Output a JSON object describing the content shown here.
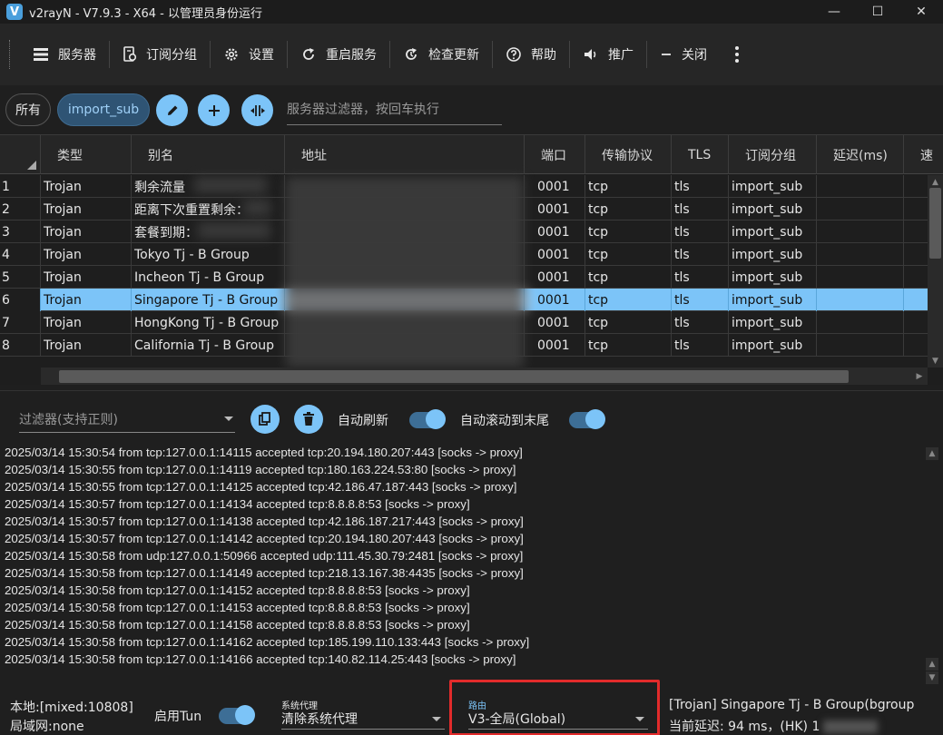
{
  "window": {
    "logo_letter": "V",
    "title": "v2rayN - V7.9.3 - X64 - 以管理员身份运行",
    "controls": {
      "minimize": "—",
      "maximize": "☐",
      "close": "✕"
    }
  },
  "toolbar": {
    "servers": "服务器",
    "subscription_group": "订阅分组",
    "settings": "设置",
    "restart_service": "重启服务",
    "check_update": "检查更新",
    "help": "帮助",
    "promote": "推广",
    "close": "关闭"
  },
  "filterbar": {
    "chip_all": "所有",
    "chip_sub": "import_sub",
    "server_filter_placeholder": "服务器过滤器，按回车执行"
  },
  "grid": {
    "columns": [
      "类型",
      "别名",
      "地址",
      "端口",
      "传输协议",
      "TLS",
      "订阅分组",
      "延迟(ms)",
      "速"
    ],
    "rows": [
      {
        "idx": "1",
        "type": "Trojan",
        "alias": "剩余流量",
        "port": "0001",
        "transport": "tcp",
        "tls": "tls",
        "sub": "import_sub"
      },
      {
        "idx": "2",
        "type": "Trojan",
        "alias": "距离下次重置剩余：",
        "port": "0001",
        "transport": "tcp",
        "tls": "tls",
        "sub": "import_sub"
      },
      {
        "idx": "3",
        "type": "Trojan",
        "alias": "套餐到期：",
        "port": "0001",
        "transport": "tcp",
        "tls": "tls",
        "sub": "import_sub"
      },
      {
        "idx": "4",
        "type": "Trojan",
        "alias": "Tokyo Tj - B Group",
        "port": "0001",
        "transport": "tcp",
        "tls": "tls",
        "sub": "import_sub"
      },
      {
        "idx": "5",
        "type": "Trojan",
        "alias": "Incheon Tj - B Group",
        "port": "0001",
        "transport": "tcp",
        "tls": "tls",
        "sub": "import_sub"
      },
      {
        "idx": "6",
        "type": "Trojan",
        "alias": "Singapore Tj - B Group",
        "port": "0001",
        "transport": "tcp",
        "tls": "tls",
        "sub": "import_sub",
        "selected": true
      },
      {
        "idx": "7",
        "type": "Trojan",
        "alias": "HongKong Tj - B Group",
        "port": "0001",
        "transport": "tcp",
        "tls": "tls",
        "sub": "import_sub"
      },
      {
        "idx": "8",
        "type": "Trojan",
        "alias": "California Tj - B Group",
        "port": "0001",
        "transport": "tcp",
        "tls": "tls",
        "sub": "import_sub"
      }
    ]
  },
  "log": {
    "filter_placeholder": "过滤器(支持正则)",
    "auto_refresh": "自动刷新",
    "auto_scroll": "自动滚动到末尾",
    "lines": [
      "2025/03/14 15:30:54 from tcp:127.0.0.1:14115 accepted tcp:20.194.180.207:443 [socks -> proxy]",
      "2025/03/14 15:30:55 from tcp:127.0.0.1:14119 accepted tcp:180.163.224.53:80 [socks -> proxy]",
      "2025/03/14 15:30:55 from tcp:127.0.0.1:14125 accepted tcp:42.186.47.187:443 [socks -> proxy]",
      "2025/03/14 15:30:57 from tcp:127.0.0.1:14134 accepted tcp:8.8.8.8:53 [socks -> proxy]",
      "2025/03/14 15:30:57 from tcp:127.0.0.1:14138 accepted tcp:42.186.187.217:443 [socks -> proxy]",
      "2025/03/14 15:30:57 from tcp:127.0.0.1:14142 accepted tcp:20.194.180.207:443 [socks -> proxy]",
      "2025/03/14 15:30:58 from udp:127.0.0.1:50966 accepted udp:111.45.30.79:2481 [socks -> proxy]",
      "2025/03/14 15:30:58 from tcp:127.0.0.1:14149 accepted tcp:218.13.167.38:4435 [socks -> proxy]",
      "2025/03/14 15:30:58 from tcp:127.0.0.1:14152 accepted tcp:8.8.8.8:53 [socks -> proxy]",
      "2025/03/14 15:30:58 from tcp:127.0.0.1:14153 accepted tcp:8.8.8.8:53 [socks -> proxy]",
      "2025/03/14 15:30:58 from tcp:127.0.0.1:14158 accepted tcp:8.8.8.8:53 [socks -> proxy]",
      "2025/03/14 15:30:58 from tcp:127.0.0.1:14162 accepted tcp:185.199.110.133:443 [socks -> proxy]",
      "2025/03/14 15:30:58 from tcp:127.0.0.1:14166 accepted tcp:140.82.114.25:443 [socks -> proxy]"
    ]
  },
  "status": {
    "local": "本地:[mixed:10808]",
    "lan": "局域网:none",
    "tun_label": "启用Tun",
    "sysproxy_caption": "系统代理",
    "sysproxy_value": "清除系统代理",
    "routing_caption": "路由",
    "routing_value": "V3-全局(Global)",
    "server_info": "[Trojan] Singapore Tj - B Group(bgroup",
    "latency": "当前延迟: 94 ms，(HK) 1"
  },
  "colors": {
    "accent": "#7cc4f8",
    "selected_row": "#7cc4f8",
    "highlight_box": "#e22b2b"
  }
}
